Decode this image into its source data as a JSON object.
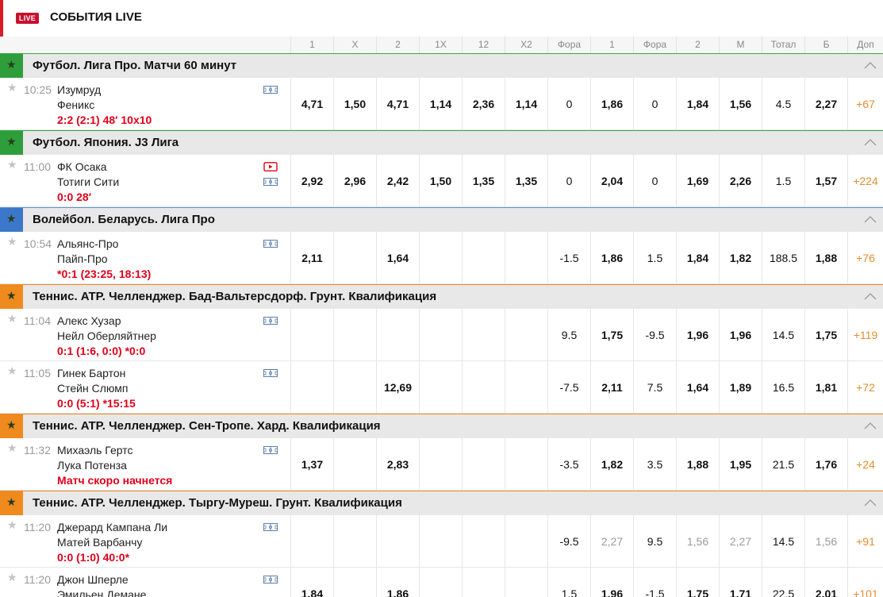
{
  "header": {
    "live_badge": "LIVE",
    "title": "СОБЫТИЯ LIVE"
  },
  "columns": [
    "1",
    "X",
    "2",
    "1X",
    "12",
    "X2",
    "Фора",
    "1",
    "Фора",
    "2",
    "М",
    "Тотал",
    "Б",
    "Доп"
  ],
  "colors": {
    "accent": "#d91c24",
    "score_red": "#e0001a",
    "more_orange": "#e88c2c",
    "football_green": "#2e9e3a",
    "volleyball_blue": "#3c78c9",
    "tennis_orange": "#ef8a1f"
  },
  "leagues": [
    {
      "name": "Футбол. Лига Про. Матчи 60 минут",
      "sport_color": "green",
      "events": [
        {
          "time": "10:25",
          "team1": "Изумруд",
          "team2": "Феникс",
          "score": "2:2 (2:1) 48′ 10x10",
          "icons": [
            "field-icon"
          ],
          "odds": [
            "4,71",
            "1,50",
            "4,71",
            "1,14",
            "2,36",
            "1,14",
            "0",
            "1,86",
            "0",
            "1,84",
            "1,56",
            "4.5",
            "2,27",
            "+67"
          ]
        }
      ]
    },
    {
      "name": "Футбол. Япония. J3 Лига",
      "sport_color": "green",
      "events": [
        {
          "time": "11:00",
          "team1": "ФК Осака",
          "team2": "Тотиги Сити",
          "score": "0:0 28′",
          "icons": [
            "video-icon",
            "field-icon"
          ],
          "odds": [
            "2,92",
            "2,96",
            "2,42",
            "1,50",
            "1,35",
            "1,35",
            "0",
            "2,04",
            "0",
            "1,69",
            "2,26",
            "1.5",
            "1,57",
            "+224"
          ]
        }
      ]
    },
    {
      "name": "Волейбол. Беларусь. Лига Про",
      "sport_color": "blue",
      "events": [
        {
          "time": "10:54",
          "team1": "Альянс-Про",
          "team2": "Пайп-Про",
          "score": "*0:1 (23:25, 18:13)",
          "icons": [
            "field-icon"
          ],
          "odds": [
            "2,11",
            "",
            "1,64",
            "",
            "",
            "",
            "-1.5",
            "1,86",
            "1.5",
            "1,84",
            "1,82",
            "188.5",
            "1,88",
            "+76"
          ]
        }
      ]
    },
    {
      "name": "Теннис. ATP. Челленджер. Бад-Вальтерсдорф. Грунт. Квалификация",
      "sport_color": "orange",
      "events": [
        {
          "time": "11:04",
          "team1": "Алекс Хузар",
          "team2": "Нейл Оберляйтнер",
          "score": "0:1 (1:6, 0:0) *0:0",
          "icons": [
            "field-icon"
          ],
          "odds": [
            "",
            "",
            "",
            "",
            "",
            "",
            "9.5",
            "1,75",
            "-9.5",
            "1,96",
            "1,96",
            "14.5",
            "1,75",
            "+119"
          ]
        },
        {
          "time": "11:05",
          "team1": "Гинек Бартон",
          "team2": "Стейн Слюмп",
          "score": "0:0 (5:1) *15:15",
          "icons": [
            "field-icon"
          ],
          "odds": [
            "",
            "",
            "12,69",
            "",
            "",
            "",
            "-7.5",
            "2,11",
            "7.5",
            "1,64",
            "1,89",
            "16.5",
            "1,81",
            "+72"
          ]
        }
      ]
    },
    {
      "name": "Теннис. ATP. Челленджер. Сен-Тропе. Хард. Квалификация",
      "sport_color": "orange",
      "events": [
        {
          "time": "11:32",
          "team1": "Михаэль Гертс",
          "team2": "Лука Потенза",
          "score": "Матч скоро начнется",
          "icons": [
            "field-icon"
          ],
          "odds": [
            "1,37",
            "",
            "2,83",
            "",
            "",
            "",
            "-3.5",
            "1,82",
            "3.5",
            "1,88",
            "1,95",
            "21.5",
            "1,76",
            "+24"
          ]
        }
      ]
    },
    {
      "name": "Теннис. ATP. Челленджер. Тыргу-Муреш. Грунт. Квалификация",
      "sport_color": "orange",
      "events": [
        {
          "time": "11:20",
          "team1": "Джерард Кампана Ли",
          "team2": "Матей Варбанчу",
          "score": "0:0 (1:0) 40:0*",
          "icons": [
            "field-icon"
          ],
          "odds": [
            "",
            "",
            "",
            "",
            "",
            "",
            "-9.5",
            "2,27",
            "9.5",
            "1,56",
            "2,27",
            "14.5",
            "1,56",
            "+91"
          ],
          "dimmed": true
        },
        {
          "time": "11:20",
          "team1": "Джон Шперле",
          "team2": "Эмильен Демане",
          "score": "",
          "icons": [
            "field-icon"
          ],
          "odds": [
            "1,84",
            "",
            "1,86",
            "",
            "",
            "",
            "1.5",
            "1,96",
            "-1.5",
            "1,75",
            "1,71",
            "22.5",
            "2,01",
            "+101"
          ]
        }
      ]
    }
  ]
}
